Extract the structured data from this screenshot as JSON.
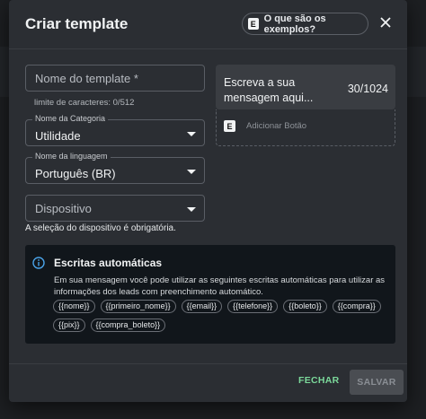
{
  "dialog": {
    "title": "Criar template",
    "examples_button": "O que são os exemplos?",
    "examples_badge": "E"
  },
  "form": {
    "template_name": {
      "placeholder": "Nome do template *",
      "helper": "limite de caracteres: 0/512"
    },
    "category": {
      "label": "Nome da Categoria",
      "value": "Utilidade"
    },
    "language": {
      "label": "Nome da linguagem",
      "value": "Português (BR)"
    },
    "device": {
      "placeholder": "Dispositivo",
      "error": "A seleção do dispositivo é obrigatória."
    }
  },
  "preview": {
    "message_placeholder": "Escreva a sua mensagem aqui...",
    "counter": "30/1024",
    "add_button_badge": "E",
    "add_button_label": "Adicionar Botão"
  },
  "info": {
    "title": "Escritas automáticas",
    "text": "Em sua mensagem você pode utilizar as seguintes escritas automáticas para utilizar as informações dos leads com preenchimento automático.",
    "chips": [
      "{{nome}}",
      "{{primeiro_nome}}",
      "{{email}}",
      "{{telefone}}",
      "{{boleto}}",
      "{{compra}}",
      "{{pix}}",
      "{{compra_boleto}}"
    ]
  },
  "footer": {
    "close_label": "FECHAR",
    "save_label": "SALVAR"
  },
  "colors": {
    "accent_green": "#7bd89a",
    "info_blue": "#4aa3e8",
    "dialog_bg": "#2b2e33"
  }
}
